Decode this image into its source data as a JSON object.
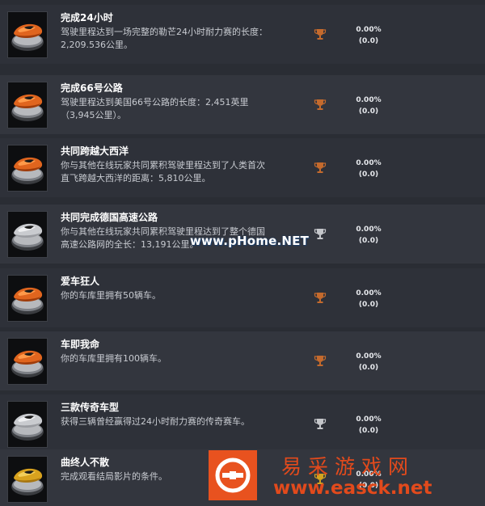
{
  "achievements": [
    {
      "title": "完成24小时",
      "desc_line1": "驾驶里程达到一场完整的勒芒24小时耐力赛的长度：",
      "desc_line2": "2,209.536公里。",
      "trophy": "bronze-trophy-icon",
      "percent": "0.00%",
      "count": "(0.0)",
      "car_color": "orange"
    },
    {
      "title": "完成66号公路",
      "desc_line1": "驾驶里程达到美国66号公路的长度：2,451英里",
      "desc_line2": "（3,945公里）。",
      "trophy": "bronze-trophy-icon",
      "percent": "0.00%",
      "count": "(0.0)",
      "car_color": "orange"
    },
    {
      "title": "共同跨越大西洋",
      "desc_line1": "你与其他在线玩家共同累积驾驶里程达到了人类首次",
      "desc_line2": "直飞跨越大西洋的距离：5,810公里。",
      "trophy": "bronze-trophy-icon",
      "percent": "0.00%",
      "count": "(0.0)",
      "car_color": "orange"
    },
    {
      "title": "共同完成德国高速公路",
      "desc_line1": "你与其他在线玩家共同累积驾驶里程达到了整个德国",
      "desc_line2": "高速公路网的全长：13,191公里。",
      "trophy": "silver-trophy-icon",
      "percent": "0.00%",
      "count": "(0.0)",
      "car_color": "silver"
    },
    {
      "title": "爱车狂人",
      "desc_line1": "你的车库里拥有50辆车。",
      "desc_line2": "",
      "trophy": "bronze-trophy-icon",
      "percent": "0.00%",
      "count": "(0.0)",
      "car_color": "orange"
    },
    {
      "title": "车即我命",
      "desc_line1": "你的车库里拥有100辆车。",
      "desc_line2": "",
      "trophy": "bronze-trophy-icon",
      "percent": "0.00%",
      "count": "(0.0)",
      "car_color": "orange"
    },
    {
      "title": "三款传奇车型",
      "desc_line1": "获得三辆曾经赢得过24小时耐力赛的传奇赛车。",
      "desc_line2": "",
      "trophy": "silver-trophy-icon",
      "percent": "0.00%",
      "count": "(0.0)",
      "car_color": "silver"
    },
    {
      "title": "曲终人不散",
      "desc_line1": "完成观看结局影片的条件。",
      "desc_line2": "",
      "trophy": "gold-trophy-icon",
      "percent": "0.00%",
      "count": "(0.0)",
      "car_color": "gold"
    }
  ],
  "colors": {
    "orange": "#e0651e",
    "silver": "#c9cbcf",
    "gold": "#d8a21e",
    "bronze_trophy": "#c46a2d",
    "silver_trophy": "#c4c6ca",
    "gold_trophy": "#d4a31f"
  },
  "watermarks": {
    "pc_home": "www.pHome.NET",
    "site_name_cn": "易采游戏网",
    "site_url": "www.easck.net"
  }
}
